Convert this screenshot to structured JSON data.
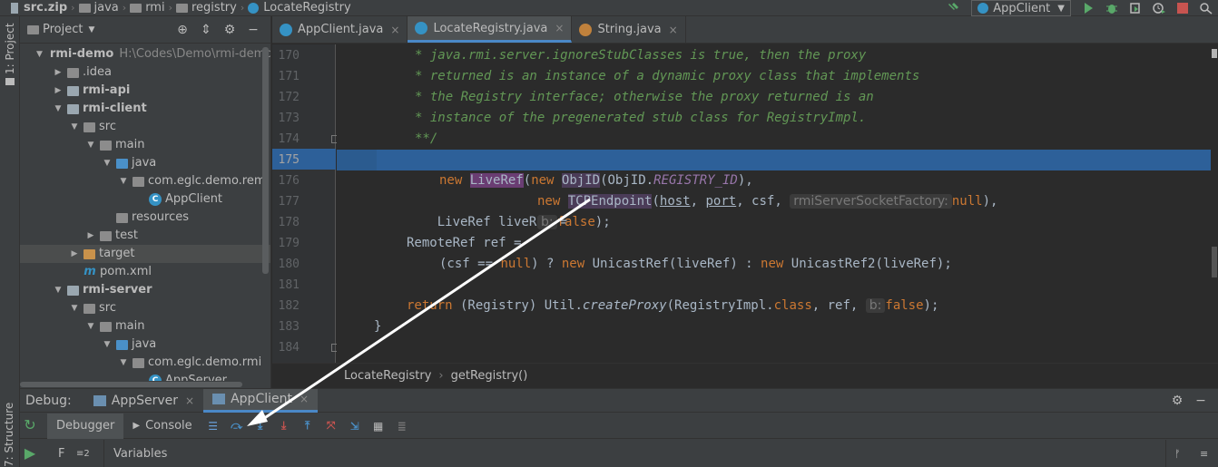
{
  "navbar": {
    "breadcrumbs": [
      "src.zip",
      "java",
      "rmi",
      "registry",
      "LocateRegistry"
    ],
    "run_config": "AppClient"
  },
  "stripe": {
    "project_label": "1: Project",
    "structure_label": "7: Structure"
  },
  "project": {
    "title": "Project",
    "tree": [
      {
        "label": "rmi-demo",
        "path": "H:\\Codes\\Demo\\rmi-demo",
        "depth": 0,
        "arrow": "down",
        "icon": "module",
        "bold": true
      },
      {
        "label": ".idea",
        "depth": 1,
        "arrow": "right",
        "icon": "folder"
      },
      {
        "label": "rmi-api",
        "depth": 1,
        "arrow": "right",
        "icon": "module",
        "bold": true
      },
      {
        "label": "rmi-client",
        "depth": 1,
        "arrow": "down",
        "icon": "module",
        "bold": true
      },
      {
        "label": "src",
        "depth": 2,
        "arrow": "down",
        "icon": "folder"
      },
      {
        "label": "main",
        "depth": 3,
        "arrow": "down",
        "icon": "folder"
      },
      {
        "label": "java",
        "depth": 4,
        "arrow": "down",
        "icon": "source-folder"
      },
      {
        "label": "com.eglc.demo.rem",
        "depth": 5,
        "arrow": "down",
        "icon": "package"
      },
      {
        "label": "AppClient",
        "depth": 6,
        "arrow": "",
        "icon": "class"
      },
      {
        "label": "resources",
        "depth": 4,
        "arrow": "",
        "icon": "folder"
      },
      {
        "label": "test",
        "depth": 3,
        "arrow": "right",
        "icon": "folder"
      },
      {
        "label": "target",
        "depth": 2,
        "arrow": "right",
        "icon": "excluded-folder",
        "selected": true
      },
      {
        "label": "pom.xml",
        "depth": 2,
        "arrow": "",
        "icon": "maven"
      },
      {
        "label": "rmi-server",
        "depth": 1,
        "arrow": "down",
        "icon": "module",
        "bold": true
      },
      {
        "label": "src",
        "depth": 2,
        "arrow": "down",
        "icon": "folder"
      },
      {
        "label": "main",
        "depth": 3,
        "arrow": "down",
        "icon": "folder"
      },
      {
        "label": "java",
        "depth": 4,
        "arrow": "down",
        "icon": "source-folder"
      },
      {
        "label": "com.eglc.demo.rmi",
        "depth": 5,
        "arrow": "down",
        "icon": "package"
      },
      {
        "label": "AppServer",
        "depth": 6,
        "arrow": "",
        "icon": "class"
      }
    ]
  },
  "editor": {
    "tabs": [
      {
        "label": "AppClient.java",
        "active": false,
        "icon": "class"
      },
      {
        "label": "LocateRegistry.java",
        "active": true,
        "icon": "class"
      },
      {
        "label": "String.java",
        "active": false,
        "icon": "class-final"
      }
    ],
    "line_numbers": [
      "170",
      "171",
      "172",
      "173",
      "174",
      "175",
      "176",
      "177",
      "178",
      "179",
      "180",
      "181",
      "182",
      "183",
      "184"
    ],
    "highlighted_line": "175",
    "code_text": {
      "l170": "* java.rmi.server.ignoreStubClasses is true, then the proxy",
      "l171": "* returned is an instance of a dynamic proxy class that implements",
      "l172": "* the Registry interface; otherwise the proxy returned is an",
      "l173": "* instance of the pregenerated stub class for RegistryImpl.",
      "l174": "**/",
      "l175": "LiveRef liveRef =",
      "l176_new": "new",
      "l176_liveref": "LiveRef",
      "l176_a": "(",
      "l176_new2": "new",
      "l176_objid": "ObjID",
      "l176_b": "(ObjID.",
      "l176_static": "REGISTRY_ID",
      "l176_c": "),",
      "l177_new": "new",
      "l177_tcp": "TCPEndpoint",
      "l177_a": "(",
      "l177_host": "host",
      "l177_comma1": ", ",
      "l177_port": "port",
      "l177_b": ", csf, ",
      "l177_hint": "rmiServerSocketFactory:",
      "l177_null": "null",
      "l177_c": "),",
      "l178_hint": "b:",
      "l178_false": "false",
      "l178_end": ");",
      "l179": "RemoteRef ref =",
      "l180_a": "(csf == ",
      "l180_null": "null",
      "l180_b": ") ? ",
      "l180_new": "new",
      "l180_c": " UnicastRef(liveRef) : ",
      "l180_new2": "new",
      "l180_d": " UnicastRef2(liveRef);",
      "l182_return": "return",
      "l182_a": " (Registry) Util.",
      "l182_method": "createProxy",
      "l182_b": "(RegistryImpl.",
      "l182_class": "class",
      "l182_c": ", ref, ",
      "l182_hint": "b:",
      "l182_false": "false",
      "l182_d": ");",
      "l183": "}"
    },
    "code_breadcrumb": [
      "LocateRegistry",
      "getRegistry()"
    ]
  },
  "debug": {
    "label": "Debug:",
    "tabs": [
      {
        "label": "AppServer",
        "active": false
      },
      {
        "label": "AppClient",
        "active": true
      }
    ],
    "subtabs": [
      "Debugger",
      "Console"
    ],
    "frames_label": "F",
    "variables_label": "Variables"
  },
  "colors": {
    "accent": "#4a88c7",
    "selection_line": "#2d6099",
    "arrow": "#ffffff"
  }
}
